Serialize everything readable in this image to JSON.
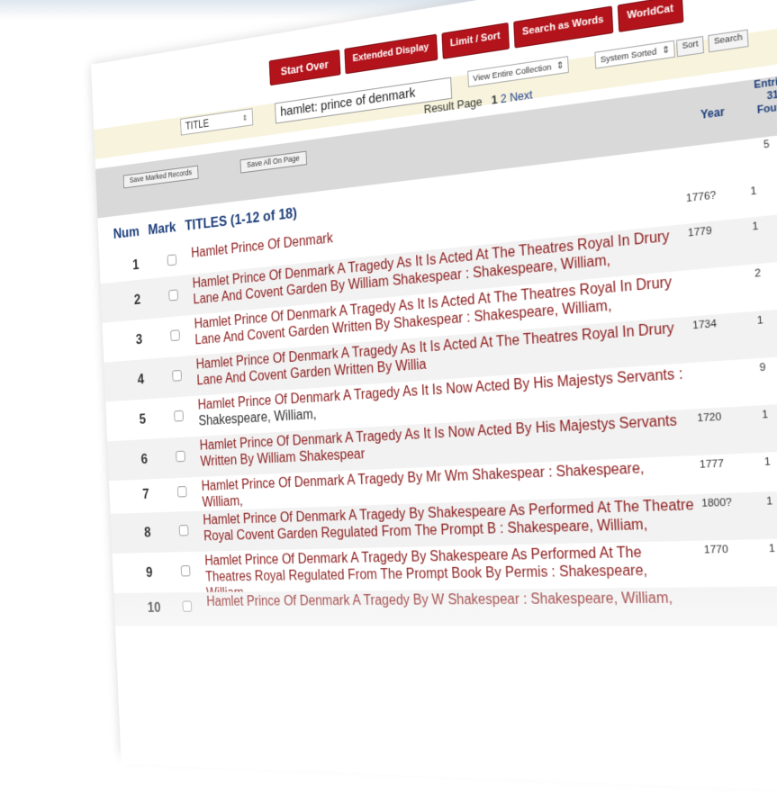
{
  "toolbar": {
    "start_over": "Start Over",
    "extended_display": "Extended Display",
    "limit_sort": "Limit / Sort",
    "search_as_words": "Search as Words",
    "worldcat": "WorldCat"
  },
  "search": {
    "field_select": "TITLE",
    "query": "hamlet: prince of denmark",
    "scope_select": "View Entire Collection",
    "sort_select": "System Sorted",
    "sort_button": "Sort",
    "search_button": "Search"
  },
  "pagination": {
    "label": "Result Page",
    "current": "1",
    "page2": "2",
    "next": "Next"
  },
  "actions": {
    "save_marked": "Save Marked Records",
    "save_all": "Save All On Page"
  },
  "columns": {
    "year": "Year",
    "entries_line1": "Entries",
    "entries_line2": "31",
    "entries_line3": "Found",
    "first_count": "5"
  },
  "heading": {
    "num": "Num",
    "mark": "Mark",
    "titles": "TITLES (1-12 of 18)"
  },
  "results": [
    {
      "num": "1",
      "title": "Hamlet Prince Of Denmark",
      "author": "",
      "year": "1776?",
      "count": "1"
    },
    {
      "num": "2",
      "title": "Hamlet Prince Of Denmark A Tragedy As It Is Acted At The Theatres Royal In Drury Lane And Covent Garden By William Shakespear : Shakespeare, William,",
      "author": "",
      "year": "1779",
      "count": "1"
    },
    {
      "num": "3",
      "title": "Hamlet Prince Of Denmark A Tragedy As It Is Acted At The Theatres Royal In Drury Lane And Covent Garden Written By Shakespear : Shakespeare, William,",
      "author": "",
      "year": "",
      "count": "2"
    },
    {
      "num": "4",
      "title": "Hamlet Prince Of Denmark A Tragedy As It Is Acted At The Theatres Royal In Drury Lane And Covent Garden Written By Willia",
      "author": "",
      "year": "1734",
      "count": "1"
    },
    {
      "num": "5",
      "title": "Hamlet Prince Of Denmark A Tragedy As It Is Now Acted By His Majestys Servants :",
      "author": "Shakespeare, William,",
      "year": "",
      "count": "9"
    },
    {
      "num": "6",
      "title": "Hamlet Prince Of Denmark A Tragedy As It Is Now Acted By His Majestys Servants Written By William Shakespear",
      "author": "",
      "year": "1720",
      "count": "1"
    },
    {
      "num": "7",
      "title": "Hamlet Prince Of Denmark A Tragedy By Mr Wm Shakespear : Shakespeare, William,",
      "author": "",
      "year": "1777",
      "count": "1"
    },
    {
      "num": "8",
      "title": "Hamlet Prince Of Denmark A Tragedy By Shakespeare As Performed At The Theatre Royal Covent Garden Regulated From The Prompt B : Shakespeare, William,",
      "author": "",
      "year": "1800?",
      "count": "1"
    },
    {
      "num": "9",
      "title": "Hamlet Prince Of Denmark A Tragedy By Shakespeare As Performed At The Theatres Royal Regulated From The Prompt Book By Permis : Shakespeare, William,",
      "author": "",
      "year": "1770",
      "count": "1"
    },
    {
      "num": "10",
      "title": "Hamlet Prince Of Denmark A Tragedy By W Shakespear : Shakespeare, William,",
      "author": "",
      "year": "",
      "count": ""
    }
  ]
}
